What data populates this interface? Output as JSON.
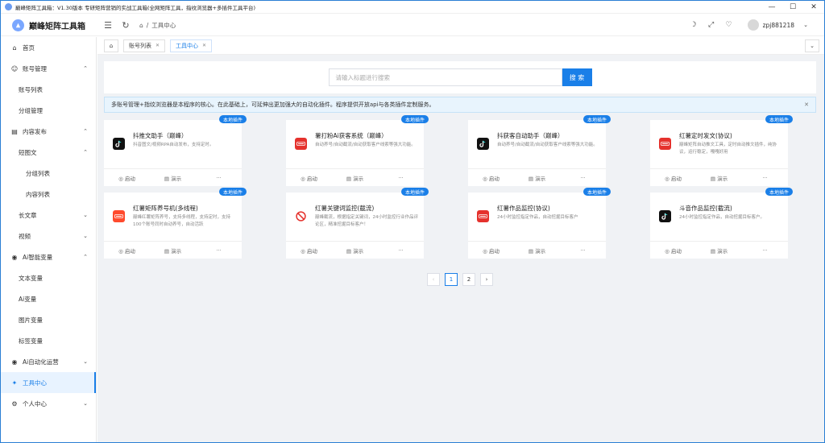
{
  "titlebar": {
    "title": "巅峰矩阵工具箱：V1.30版本  专研矩阵营销的实战工具箱(全网矩阵工具，指纹浏览器+多插件工具平台)"
  },
  "header": {
    "brand": "巅峰矩阵工具箱",
    "breadcrumb": "工具中心",
    "username": "zpj881218"
  },
  "sidebar": {
    "home": "首页",
    "account_mgmt": "账号管理",
    "account_list": "账号列表",
    "group_mgmt": "分组管理",
    "content_publish": "内容发布",
    "short_post": "短图文",
    "group_list": "分组列表",
    "content_list": "内容列表",
    "long_article": "长文章",
    "video": "视频",
    "ai_vars": "Ai智能变量",
    "text_vars": "文本变量",
    "ai_var": "Ai变量",
    "image_vars": "图片变量",
    "tag_vars": "标签变量",
    "ai_ops": "Ai自动化运营",
    "tool_center": "工具中心",
    "personal_center": "个人中心"
  },
  "tabs": [
    {
      "label": "账号列表"
    },
    {
      "label": "工具中心"
    }
  ],
  "search": {
    "placeholder": "请输入标题进行搜索",
    "button": "搜 索"
  },
  "notice": "多账号管理+指纹浏览器是本程序的核心。在此基础上，可延伸出更加强大的自动化插件。程序提供开放api与各类插件定制服务。",
  "cards": [
    {
      "title": "抖推文助手（巅峰）",
      "desc": "抖音图文/视频RPA自动发布，支持定时。",
      "badge": "本地插件",
      "icon": "douyin-icon",
      "color": "#111111"
    },
    {
      "title": "薯打粉Ai获客系统（巅峰）",
      "desc": "自动养号/自动截流/自动获取客户线索等强大功能。",
      "badge": "本地插件",
      "icon": "xiaohongshu-icon",
      "color": "#e5322d"
    },
    {
      "title": "抖获客自动助手（巅峰）",
      "desc": "自动养号/自动截流/自动获取客户线索等强大功能。",
      "badge": "本地插件",
      "icon": "douyin-icon",
      "color": "#111111"
    },
    {
      "title": "红薯定时发文(协议)",
      "desc": "巅峰矩阵自动推文工具，定时自动推文插件，纯协议，运行稳定，嘎嘎好用",
      "badge": "本地插件",
      "icon": "xiaohongshu-icon",
      "color": "#e5322d"
    },
    {
      "title": "红薯矩阵养号机(多线程)",
      "desc": "巅峰红薯矩阵养号，支持多线程，支持定时，支持100个账号同时自动养号，自动活跃",
      "badge": "本地插件",
      "icon": "xiaohongshu-icon",
      "color": "#ff4a2d"
    },
    {
      "title": "红薯关键词监控(截流)",
      "desc": "巅峰截流，根据指定关键词，24小时监控行业作品评论区，精准挖掘目标客户！",
      "badge": "本地插件",
      "icon": "forbidden-icon",
      "color": "#e5322d"
    },
    {
      "title": "红薯作品监控(协议)",
      "desc": "24小时监控指定作品，自动挖掘目标客户",
      "badge": "本地插件",
      "icon": "xiaohongshu-icon",
      "color": "#e5322d"
    },
    {
      "title": "斗音作品监控(截流)",
      "desc": "24小时监控指定作品，自动挖掘目标客户。",
      "badge": "本地插件",
      "icon": "douyin-icon",
      "color": "#111111"
    }
  ],
  "card_actions": {
    "start": "启动",
    "demo": "演示",
    "more": "···"
  },
  "pagination": {
    "pages": [
      "1",
      "2"
    ],
    "current": "1"
  }
}
